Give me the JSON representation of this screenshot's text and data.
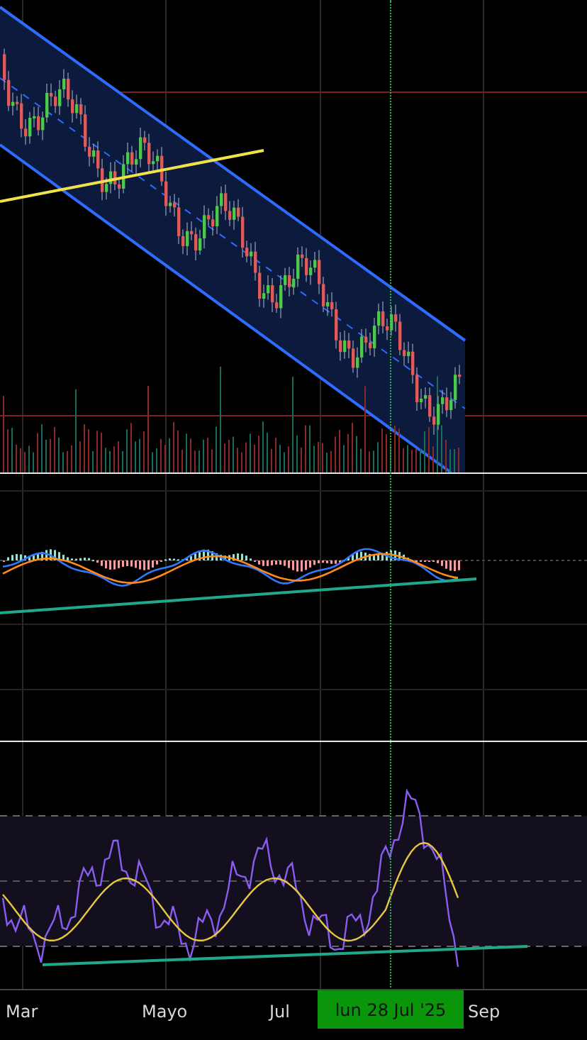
{
  "x_axis": {
    "labels": [
      {
        "text": "Mar"
      },
      {
        "text": "Mayo"
      },
      {
        "text": "Jul"
      },
      {
        "text": "Sep"
      }
    ]
  },
  "crosshair": {
    "label": "lun 28 Jul '25"
  }
}
